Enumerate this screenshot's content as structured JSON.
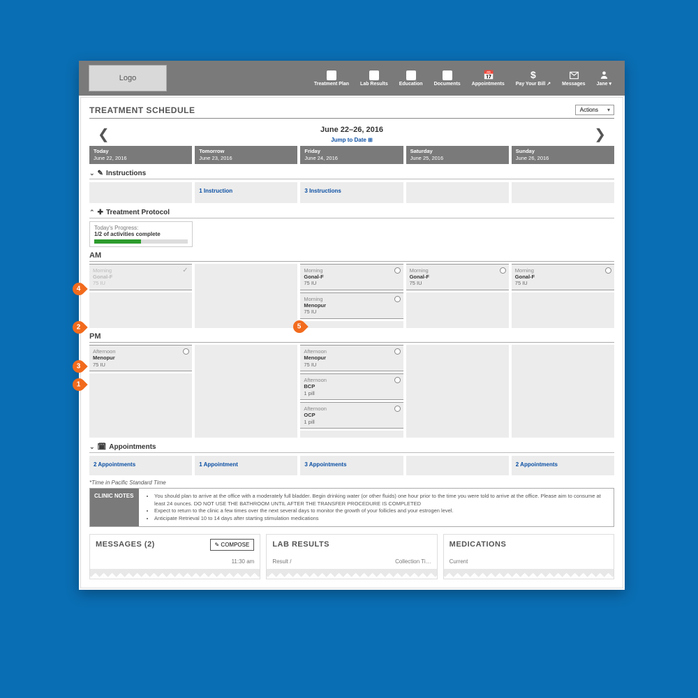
{
  "logo_text": "Logo",
  "nav": [
    {
      "label": "Treatment Plan",
      "icon": "square"
    },
    {
      "label": "Lab Results",
      "icon": "square"
    },
    {
      "label": "Education",
      "icon": "square"
    },
    {
      "label": "Documents",
      "icon": "square"
    },
    {
      "label": "Appointments",
      "icon": "cal"
    },
    {
      "label": "Pay Your Bill ↗",
      "icon": "dollar"
    },
    {
      "label": "Messages",
      "icon": "envelope"
    },
    {
      "label": "Jane ▾",
      "icon": "person"
    }
  ],
  "page_title": "TREATMENT SCHEDULE",
  "actions_label": "Actions",
  "date_range": "June 22–26, 2016",
  "jump_label": "Jump to Date ⊞",
  "days": [
    {
      "label": "Today",
      "date": "June 22, 2016"
    },
    {
      "label": "Tomorrow",
      "date": "June 23, 2016"
    },
    {
      "label": "Friday",
      "date": "June 24, 2016"
    },
    {
      "label": "Saturday",
      "date": "June 25, 2016"
    },
    {
      "label": "Sunday",
      "date": "June 26, 2016"
    }
  ],
  "sections": {
    "instructions": {
      "title": "Instructions",
      "cells": [
        "",
        "1 Instruction",
        "3 Instructions",
        "",
        ""
      ]
    },
    "protocol": {
      "title": "Treatment Protocol",
      "progress_label": "Today's Progress:",
      "progress_status": "1/2 of activities complete",
      "progress_pct": 50,
      "am_label": "AM",
      "pm_label": "PM",
      "am": [
        [
          {
            "t": "Morning",
            "n": "Gonal-F",
            "d": "75 IU",
            "done": true
          }
        ],
        [],
        [
          {
            "t": "Morning",
            "n": "Gonal-F",
            "d": "75 IU"
          },
          {
            "t": "Morning",
            "n": "Menopur",
            "d": "75 IU"
          }
        ],
        [
          {
            "t": "Morning",
            "n": "Gonal-F",
            "d": "75 IU"
          }
        ],
        [
          {
            "t": "Morning",
            "n": "Gonal-F",
            "d": "75 IU"
          }
        ]
      ],
      "pm": [
        [
          {
            "t": "Afternoon",
            "n": "Menopur",
            "d": "75 IU"
          }
        ],
        [],
        [
          {
            "t": "Afternoon",
            "n": "Menopur",
            "d": "75 IU"
          },
          {
            "t": "Afternoon",
            "n": "BCP",
            "d": "1 pill"
          },
          {
            "t": "Afternoon",
            "n": "OCP",
            "d": "1 pill"
          }
        ],
        [],
        []
      ]
    },
    "appointments": {
      "title": "Appointments",
      "cells": [
        "2 Appointments",
        "1 Appointment",
        "3 Appointments",
        "",
        "2 Appointments"
      ]
    }
  },
  "tz_note": "*Time in Pacific Standard Time",
  "clinic_notes": {
    "label": "CLINIC NOTES",
    "items": [
      "You should plan to arrive at the office with a moderately full bladder. Begin drinking water (or other fluids) one hour prior to the time you were told to arrive at the office. Please aim to consume at least 24 ounces. DO NOT USE THE BATHROOM UNTIL AFTER THE TRANSFER PROCEDURE IS COMPLETED",
      "Expect to return to the clinic a few times over the next several days to monitor the growth of your follicles and your estrogen level.",
      "Anticipate Retrieval 10 to 14 days after starting stimulation medications"
    ]
  },
  "panels": {
    "messages": {
      "title": "MESSAGES (2)",
      "compose": "✎ COMPOSE",
      "sub_right": "11:30 am"
    },
    "labs": {
      "title": "LAB RESULTS",
      "sub_left": "Result /",
      "sub_right": "Collection Ti…"
    },
    "meds": {
      "title": "MEDICATIONS",
      "sub_left": "Current"
    }
  },
  "markers": {
    "1": "1",
    "2": "2",
    "3": "3",
    "4": "4",
    "5": "5"
  }
}
